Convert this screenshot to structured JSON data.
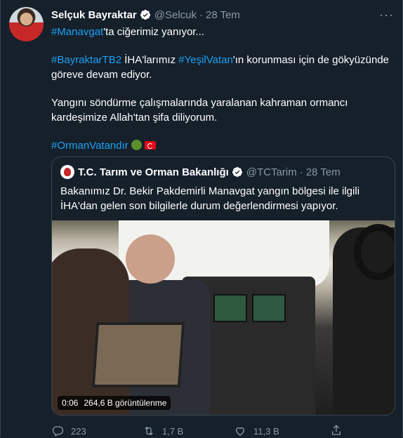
{
  "tweet": {
    "author_name": "Selçuk Bayraktar",
    "author_handle": "@Selcuk",
    "separator": "·",
    "date": "28 Tem",
    "more": "···",
    "paragraph1": {
      "hashtag": "#Manavgat",
      "text": "'ta ciğerimiz yanıyor..."
    },
    "paragraph2": {
      "hashtag1": "#BayraktarTB2",
      "text1": " İHA'larımız ",
      "hashtag2": "#YeşilVatan",
      "text2": "'ın korunması için de gökyüzünde göreve devam ediyor."
    },
    "paragraph3": "Yangını söndürme çalışmalarında yaralanan kahraman ormancı kardeşimize Allah'tan şifa diliyorum.",
    "paragraph4": {
      "hashtag": "#OrmanVatandır"
    }
  },
  "quote": {
    "author_name": "T.C. Tarım ve Orman Bakanlığı",
    "author_handle": "@TCTarim",
    "separator": "·",
    "date": "28 Tem",
    "text": "Bakanımız Dr. Bekir Pakdemirli Manavgat yangın bölgesi ile ilgili İHA'dan gelen son bilgilerle durum değerlendirmesi yapıyor.",
    "video": {
      "duration": "0:06",
      "views": "264,6 B görüntülenme"
    }
  },
  "actions": {
    "reply_count": "223",
    "retweet_count": "1,7 B",
    "like_count": "11,3 B"
  },
  "colors": {
    "background": "#15202b",
    "link": "#1da1f2",
    "muted": "#8899a6",
    "border": "#38444d"
  }
}
